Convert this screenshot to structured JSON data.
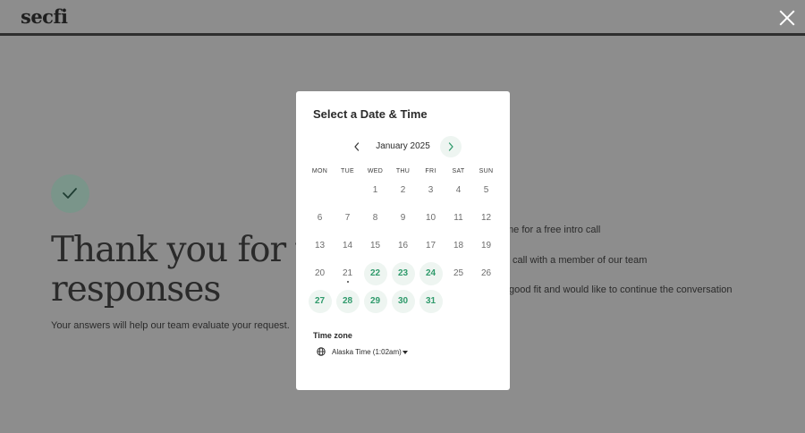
{
  "header": {
    "logo_text": "secfi",
    "close_icon": "close-icon"
  },
  "background": {
    "headline_line1": "Thank you for your",
    "headline_line2": "responses",
    "subtext": "Your answers will help our team evaluate your request.",
    "steps": [
      "me for a free intro call",
      "call with a member of our team",
      "good fit and would like to continue the conversation"
    ]
  },
  "modal": {
    "title": "Select a Date & Time",
    "month_label": "January 2025",
    "weekdays": [
      "MON",
      "TUE",
      "WED",
      "THU",
      "FRI",
      "SAT",
      "SUN"
    ],
    "days": [
      {
        "label": "1",
        "available": false
      },
      {
        "label": "2",
        "available": false
      },
      {
        "label": "3",
        "available": false
      },
      {
        "label": "4",
        "available": false
      },
      {
        "label": "5",
        "available": false
      },
      {
        "label": "6",
        "available": false
      },
      {
        "label": "7",
        "available": false
      },
      {
        "label": "8",
        "available": false
      },
      {
        "label": "9",
        "available": false
      },
      {
        "label": "10",
        "available": false
      },
      {
        "label": "11",
        "available": false
      },
      {
        "label": "12",
        "available": false
      },
      {
        "label": "13",
        "available": false
      },
      {
        "label": "14",
        "available": false
      },
      {
        "label": "15",
        "available": false
      },
      {
        "label": "16",
        "available": false
      },
      {
        "label": "17",
        "available": false
      },
      {
        "label": "18",
        "available": false
      },
      {
        "label": "19",
        "available": false
      },
      {
        "label": "20",
        "available": false
      },
      {
        "label": "21",
        "available": false,
        "today": true
      },
      {
        "label": "22",
        "available": true
      },
      {
        "label": "23",
        "available": true
      },
      {
        "label": "24",
        "available": true
      },
      {
        "label": "25",
        "available": false
      },
      {
        "label": "26",
        "available": false
      },
      {
        "label": "27",
        "available": true
      },
      {
        "label": "28",
        "available": true
      },
      {
        "label": "29",
        "available": true
      },
      {
        "label": "30",
        "available": true
      },
      {
        "label": "31",
        "available": true
      }
    ],
    "timezone_label": "Time zone",
    "timezone_value": "Alaska Time (1:02am)",
    "colors": {
      "available_text": "#2f9a6b",
      "available_bg": "#eef5f1",
      "overlay": "#8d8d8d"
    }
  }
}
